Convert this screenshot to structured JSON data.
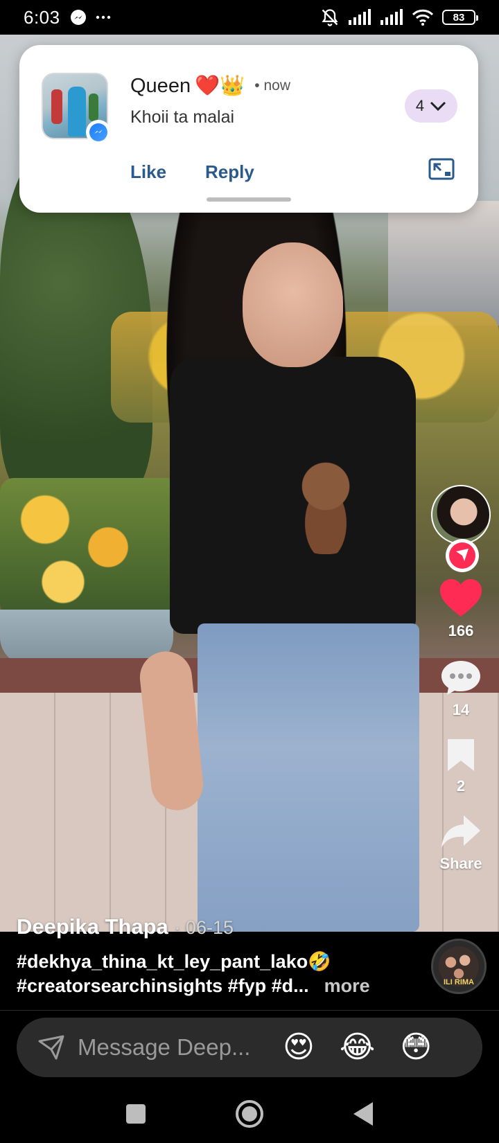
{
  "status_bar": {
    "time": "6:03",
    "battery": "83",
    "icons": [
      "messenger-icon",
      "more-dots-icon",
      "silent-bell-icon",
      "signal-icon",
      "signal-icon",
      "wifi-icon",
      "battery-icon"
    ]
  },
  "notification": {
    "sender": "Queen",
    "sender_emoji": "❤️👑",
    "time": "• now",
    "message": "Khoii ta malai",
    "count": "4",
    "like_label": "Like",
    "reply_label": "Reply",
    "app_badge": "messenger-badge-icon"
  },
  "video": {
    "author": "Deepika Thapa",
    "date": "· 06-15",
    "caption_line1": "#dekhya_thina_kt_ley_pant_lako🤣",
    "caption_line2": "#creatorsearchinsights #fyp #d...",
    "more_label": "more",
    "music_disc_text": "ILI RIMA"
  },
  "rail": {
    "likes": "166",
    "comments": "14",
    "saves": "2",
    "share_label": "Share",
    "like_color": "#fe2c55"
  },
  "message_bar": {
    "placeholder": "Message Deep...",
    "emojis": [
      "😍",
      "😂",
      "😳"
    ]
  }
}
